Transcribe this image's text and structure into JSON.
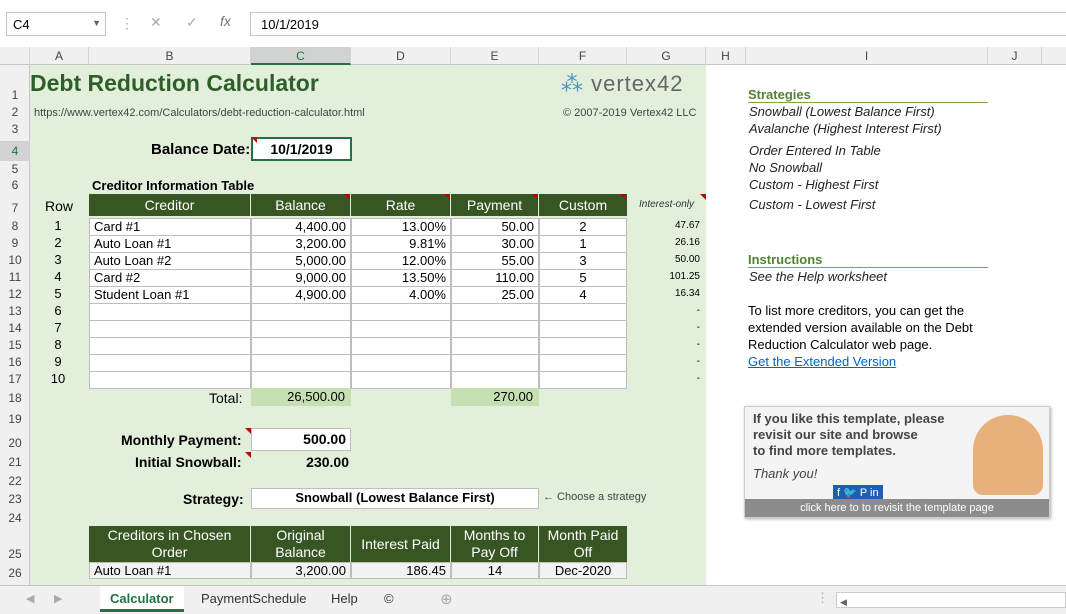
{
  "formula_bar": {
    "name_box": "C4",
    "formula": "10/1/2019"
  },
  "columns": [
    "A",
    "B",
    "C",
    "D",
    "E",
    "F",
    "G",
    "H",
    "I",
    "J"
  ],
  "rows": [
    "1",
    "2",
    "3",
    "4",
    "5",
    "6",
    "7",
    "8",
    "9",
    "10",
    "11",
    "12",
    "13",
    "14",
    "15",
    "16",
    "17",
    "18",
    "19",
    "20",
    "21",
    "22",
    "23",
    "24",
    "25",
    "26"
  ],
  "sheet": {
    "title": "Debt Reduction Calculator",
    "url": "https://www.vertex42.com/Calculators/debt-reduction-calculator.html",
    "copyright": "© 2007-2019 Vertex42 LLC",
    "logo": "vertex42",
    "balance_date_label": "Balance Date:",
    "balance_date": "10/1/2019",
    "creditor_table_title": "Creditor Information Table",
    "row_label": "Row",
    "headers": [
      "Creditor",
      "Balance",
      "Rate",
      "Payment",
      "Custom"
    ],
    "interest_only_label": "Interest-only",
    "creditors": [
      {
        "row": "1",
        "name": "Card #1",
        "balance": "4,400.00",
        "rate": "13.00%",
        "payment": "50.00",
        "custom": "2",
        "interest": "47.67"
      },
      {
        "row": "2",
        "name": "Auto Loan #1",
        "balance": "3,200.00",
        "rate": "9.81%",
        "payment": "30.00",
        "custom": "1",
        "interest": "26.16"
      },
      {
        "row": "3",
        "name": "Auto Loan #2",
        "balance": "5,000.00",
        "rate": "12.00%",
        "payment": "55.00",
        "custom": "3",
        "interest": "50.00"
      },
      {
        "row": "4",
        "name": "Card #2",
        "balance": "9,000.00",
        "rate": "13.50%",
        "payment": "110.00",
        "custom": "5",
        "interest": "101.25"
      },
      {
        "row": "5",
        "name": "Student Loan #1",
        "balance": "4,900.00",
        "rate": "4.00%",
        "payment": "25.00",
        "custom": "4",
        "interest": "16.34"
      },
      {
        "row": "6",
        "name": "",
        "balance": "",
        "rate": "",
        "payment": "",
        "custom": "",
        "interest": "-"
      },
      {
        "row": "7",
        "name": "",
        "balance": "",
        "rate": "",
        "payment": "",
        "custom": "",
        "interest": "-"
      },
      {
        "row": "8",
        "name": "",
        "balance": "",
        "rate": "",
        "payment": "",
        "custom": "",
        "interest": "-"
      },
      {
        "row": "9",
        "name": "",
        "balance": "",
        "rate": "",
        "payment": "",
        "custom": "",
        "interest": "-"
      },
      {
        "row": "10",
        "name": "",
        "balance": "",
        "rate": "",
        "payment": "",
        "custom": "",
        "interest": "-"
      }
    ],
    "total_label": "Total:",
    "total_balance": "26,500.00",
    "total_payment": "270.00",
    "monthly_payment_label": "Monthly Payment:",
    "monthly_payment": "500.00",
    "initial_snowball_label": "Initial Snowball:",
    "initial_snowball": "230.00",
    "strategy_label": "Strategy:",
    "strategy": "Snowball (Lowest Balance First)",
    "choose_strategy": "← Choose a strategy",
    "order_headers": [
      "Creditors in Chosen Order",
      "Original Balance",
      "Interest Paid",
      "Months to Pay Off",
      "Month Paid Off"
    ],
    "order_rows": [
      {
        "name": "Auto Loan #1",
        "balance": "3,200.00",
        "interest": "186.45",
        "months": "14",
        "paid": "Dec-2020"
      }
    ]
  },
  "panel": {
    "strategies_title": "Strategies",
    "strategies": [
      "Snowball (Lowest Balance First)",
      "Avalanche (Highest Interest First)",
      "Order Entered In Table",
      "No Snowball",
      "Custom - Highest First",
      "Custom - Lowest First"
    ],
    "instructions_title": "Instructions",
    "instructions_text": "See the Help worksheet",
    "more_lines": [
      "To list more creditors, you can get the",
      "extended version available on the Debt",
      "Reduction Calculator web page."
    ],
    "extended_link": "Get the Extended Version"
  },
  "ad": {
    "lines": [
      "If you like this template, please",
      "revisit our site and browse",
      "to find more templates."
    ],
    "thanks": "Thank you!",
    "click": "click here to to revisit the template page"
  },
  "tabs": [
    "Calculator",
    "PaymentSchedule",
    "Help",
    "©"
  ]
}
